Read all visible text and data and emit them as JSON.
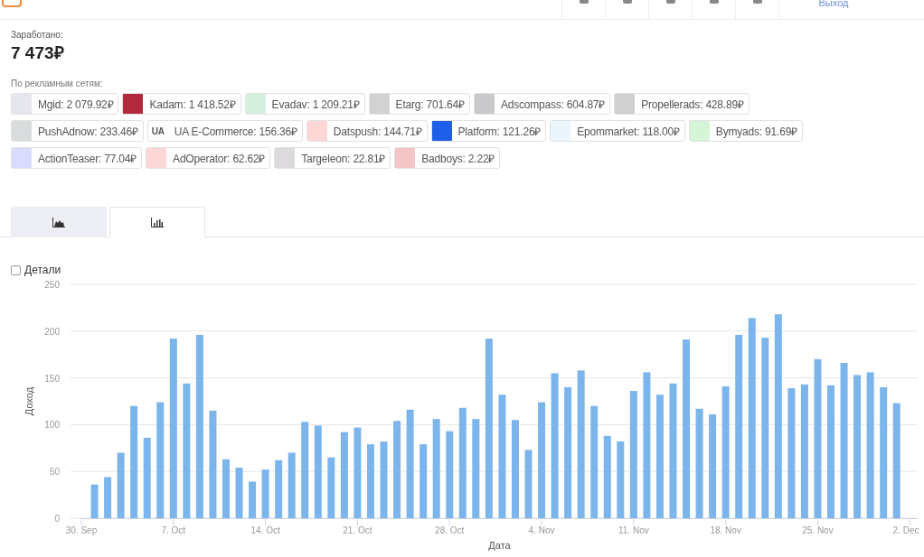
{
  "header": {
    "logout_link": "Выход"
  },
  "earnings": {
    "label": "Заработано:",
    "total": "7 473₽"
  },
  "networks": {
    "label": "По рекламным сетям:",
    "items": [
      {
        "name": "Mgid: 2 079.92₽",
        "kind": "logo",
        "color": "#e6e6ee"
      },
      {
        "name": "Kadam: 1 418.52₽",
        "kind": "logo",
        "color": "#b3283c"
      },
      {
        "name": "Evadav: 1 209.21₽",
        "kind": "logo",
        "color": "#d6f0df"
      },
      {
        "name": "Etarg: 701.64₽",
        "kind": "logo",
        "color": "#d2d2d2"
      },
      {
        "name": "Adscompass: 604.87₽",
        "kind": "logo",
        "color": "#c9c9cc"
      },
      {
        "name": "Propellerads: 428.89₽",
        "kind": "logo",
        "color": "#d0d0d0"
      },
      {
        "name": "PushAdnow: 233.46₽",
        "kind": "logo",
        "color": "#d8dcdc"
      },
      {
        "name": "UA E-Commerce: 156.36₽",
        "kind": "text",
        "icon_text": "UA"
      },
      {
        "name": "Datspush: 144.71₽",
        "kind": "logo",
        "color": "#fdd6d6"
      },
      {
        "name": "Platform: 121.26₽",
        "kind": "logo",
        "color": "#1e5ee8"
      },
      {
        "name": "Epommarket: 118.00₽",
        "kind": "logo",
        "color": "#eaf6fb"
      },
      {
        "name": "Bymyads: 91.69₽",
        "kind": "logo",
        "color": "#d6f4d6"
      },
      {
        "name": "ActionTeaser: 77.04₽",
        "kind": "logo",
        "color": "#d9dcff"
      },
      {
        "name": "AdOperator: 62.62₽",
        "kind": "logo",
        "color": "#fdd6d6"
      },
      {
        "name": "Targeleon: 22.81₽",
        "kind": "logo",
        "color": "#dcdadc"
      },
      {
        "name": "Badboys: 2.22₽",
        "kind": "logo",
        "color": "#f2c6c6"
      }
    ]
  },
  "tabs": [
    {
      "kind": "area",
      "selected": false
    },
    {
      "kind": "bar",
      "selected": true
    }
  ],
  "details": {
    "label": "Детали",
    "checked": false
  },
  "chart": {
    "chart_data": {
      "type": "bar",
      "xlabel": "Дата",
      "ylabel": "Доход",
      "categories": [
        "30. Sep",
        null,
        null,
        null,
        null,
        null,
        null,
        "7. Oct",
        null,
        null,
        null,
        null,
        null,
        null,
        "14. Oct",
        null,
        null,
        null,
        null,
        null,
        null,
        "21. Oct",
        null,
        null,
        null,
        null,
        null,
        null,
        "28. Oct",
        null,
        null,
        null,
        null,
        null,
        null,
        "4. Nov",
        null,
        null,
        null,
        null,
        null,
        null,
        "11. Nov",
        null,
        null,
        null,
        null,
        null,
        null,
        "18. Nov",
        null,
        null,
        null,
        null,
        null,
        null,
        "25. Nov",
        null,
        null,
        null,
        null,
        null,
        null,
        "2. Dec"
      ],
      "series": [
        {
          "color": "#7cb5ec",
          "values": [
            null,
            36,
            44,
            70,
            120,
            86,
            124,
            192,
            144,
            196,
            115,
            63,
            54,
            39,
            52,
            62,
            70,
            103,
            99,
            65,
            92,
            97,
            79,
            82,
            104,
            116,
            79,
            106,
            93,
            118,
            106,
            192,
            132,
            105,
            73,
            124,
            155,
            140,
            158,
            120,
            88,
            82,
            136,
            156,
            132,
            144,
            191,
            117,
            111,
            141,
            196,
            214,
            193,
            218,
            139,
            143,
            170,
            142,
            166,
            153,
            156,
            140,
            123,
            null
          ]
        }
      ],
      "grid": true,
      "ylim": [
        0,
        250
      ],
      "yticks": [
        0,
        50,
        100,
        150,
        200,
        250
      ]
    }
  }
}
